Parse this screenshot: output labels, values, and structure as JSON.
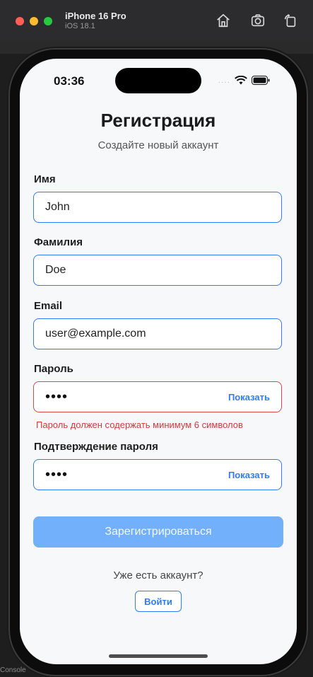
{
  "simulator": {
    "device_name": "iPhone 16 Pro",
    "os_version": "iOS 18.1",
    "console_label": "Console"
  },
  "status_bar": {
    "time": "03:36"
  },
  "screen": {
    "title": "Регистрация",
    "subtitle": "Создайте новый аккаунт"
  },
  "form": {
    "first_name": {
      "label": "Имя",
      "value": "John"
    },
    "last_name": {
      "label": "Фамилия",
      "value": "Doe"
    },
    "email": {
      "label": "Email",
      "value": "user@example.com"
    },
    "password": {
      "label": "Пароль",
      "value": "••••",
      "toggle_label": "Показать",
      "error": "Пароль должен содержать минимум 6 символов"
    },
    "confirm_password": {
      "label": "Подтверждение пароля",
      "value": "••••",
      "toggle_label": "Показать"
    }
  },
  "actions": {
    "register_label": "Зарегистрироваться",
    "have_account_text": "Уже есть аккаунт?",
    "login_label": "Войти"
  },
  "colors": {
    "accent": "#2f7cf6",
    "error": "#d23b3b",
    "disabled_button": "#72b0fb",
    "background": "#f7f8fa"
  }
}
